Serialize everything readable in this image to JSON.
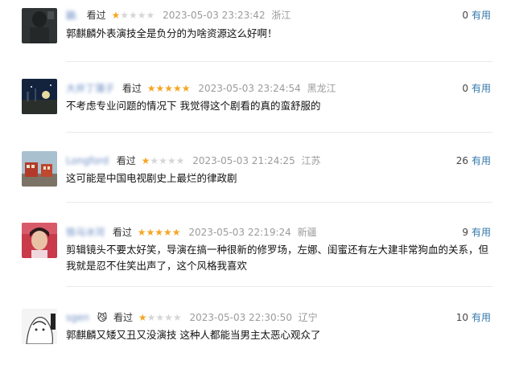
{
  "reviews": [
    {
      "username": "鼬.",
      "watched_label": "看过",
      "rating": 1,
      "time": "2023-05-03 23:23:42",
      "location": "浙江",
      "useful_count": "0",
      "useful_label": "有用",
      "content": "郭麒麟外表演技全是负分的为啥资源这么好啊！"
    },
    {
      "username": "大井丁蒲子",
      "watched_label": "看过",
      "rating": 5,
      "time": "2023-05-03 23:24:54",
      "location": "黑龙江",
      "useful_count": "0",
      "useful_label": "有用",
      "content": "不考虑专业问题的情况下 我觉得这个剧看的真的蛮舒服的"
    },
    {
      "username": "Longford",
      "watched_label": "看过",
      "rating": 1,
      "time": "2023-05-03 21:24:25",
      "location": "江苏",
      "useful_count": "26",
      "useful_label": "有用",
      "content": "这可能是中国电视剧史上最烂的律政剧"
    },
    {
      "username": "铁马冰河",
      "watched_label": "看过",
      "rating": 5,
      "time": "2023-05-03 22:19:24",
      "location": "新疆",
      "useful_count": "9",
      "useful_label": "有用",
      "content": "剪辑镜头不要太好笑，导演在搞一种很新的修罗场，左娜、闺蜜还有左大建非常狗血的关系，但我就是忍不住笑出声了，这个风格我喜欢"
    },
    {
      "username": "sgen",
      "badge": "😼",
      "watched_label": "看过",
      "rating": 1,
      "time": "2023-05-03 22:30:50",
      "location": "辽宁",
      "useful_count": "10",
      "useful_label": "有用",
      "content": "郭麒麟又矮又丑又没演技 这种人都能当男主太恶心观众了"
    }
  ]
}
